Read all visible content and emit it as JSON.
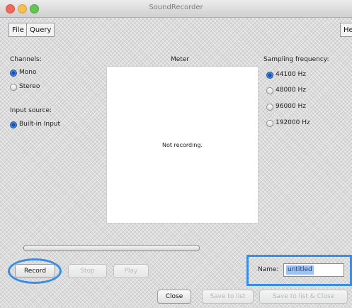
{
  "window": {
    "title": "SoundRecorder"
  },
  "menu": {
    "file": "File",
    "query": "Query",
    "help": "Help"
  },
  "channels": {
    "label": "Channels:",
    "options": [
      {
        "label": "Mono",
        "selected": true
      },
      {
        "label": "Stereo",
        "selected": false
      }
    ]
  },
  "input_source": {
    "label": "Input source:",
    "options": [
      {
        "label": "Built-in Input",
        "selected": true
      }
    ]
  },
  "meter": {
    "label": "Meter",
    "status": "Not recording."
  },
  "sampling": {
    "label": "Sampling frequency:",
    "options": [
      {
        "label": "44100 Hz",
        "selected": true
      },
      {
        "label": "48000 Hz",
        "selected": false
      },
      {
        "label": "96000 Hz",
        "selected": false
      },
      {
        "label": "192000 Hz",
        "selected": false
      }
    ]
  },
  "progress": {
    "value": 0
  },
  "buttons": {
    "record": "Record",
    "stop": "Stop",
    "play": "Play",
    "close": "Close",
    "save_list": "Save to list",
    "save_close": "Save to list & Close"
  },
  "name": {
    "label": "Name:",
    "value": "untitled"
  },
  "colors": {
    "highlight": "#3b8ce5",
    "selection": "#9ec3f3"
  }
}
